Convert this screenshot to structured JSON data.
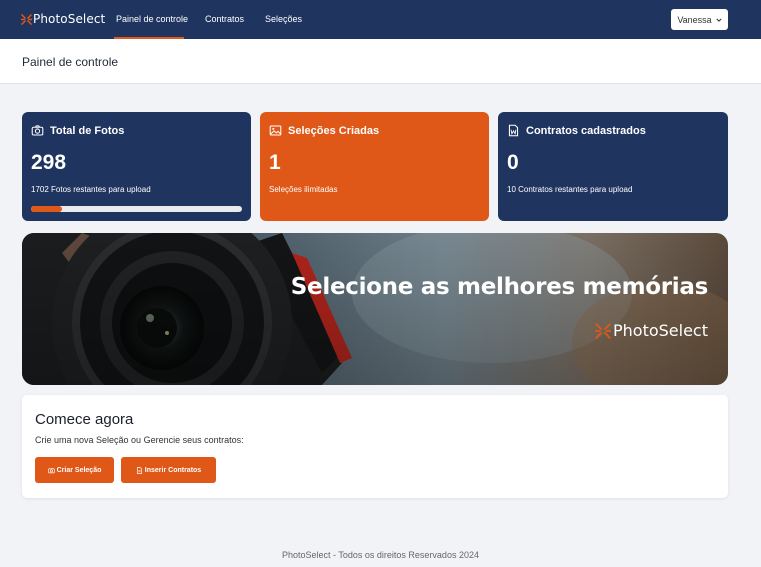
{
  "brand": {
    "name": "PhotoSelect",
    "accent": "#e05818",
    "navy": "#1f3560"
  },
  "nav": {
    "links": [
      {
        "label": "Painel de controle"
      },
      {
        "label": "Contratos"
      },
      {
        "label": "Seleções"
      }
    ],
    "active_index": 0,
    "user": {
      "label": "Vanessa",
      "icon": "chevron-down-icon"
    }
  },
  "page": {
    "title": "Painel de controle"
  },
  "cards": [
    {
      "icon": "camera-icon",
      "title": "Total de Fotos",
      "value": "298",
      "subtitle": "1702 Fotos restantes para upload",
      "progress": 0.149
    },
    {
      "icon": "image-icon",
      "title": "Seleções Criadas",
      "value": "1",
      "subtitle": "Seleções ilimitadas"
    },
    {
      "icon": "word-document-icon",
      "title": "Contratos cadastrados",
      "value": "0",
      "subtitle": "10 Contratos restantes para upload"
    }
  ],
  "banner": {
    "headline": "Selecione as melhores memórias",
    "brand": "PhotoSelect"
  },
  "start": {
    "title": "Comece agora",
    "text": "Crie uma nova Seleção ou Gerencie seus contratos:",
    "buttons": [
      {
        "label": "Criar Seleção",
        "icon": "camera-icon"
      },
      {
        "label": "Inserir Contratos",
        "icon": "document-icon"
      }
    ]
  },
  "footer": {
    "text": "PhotoSelect - Todos os direitos Reservados 2024"
  }
}
